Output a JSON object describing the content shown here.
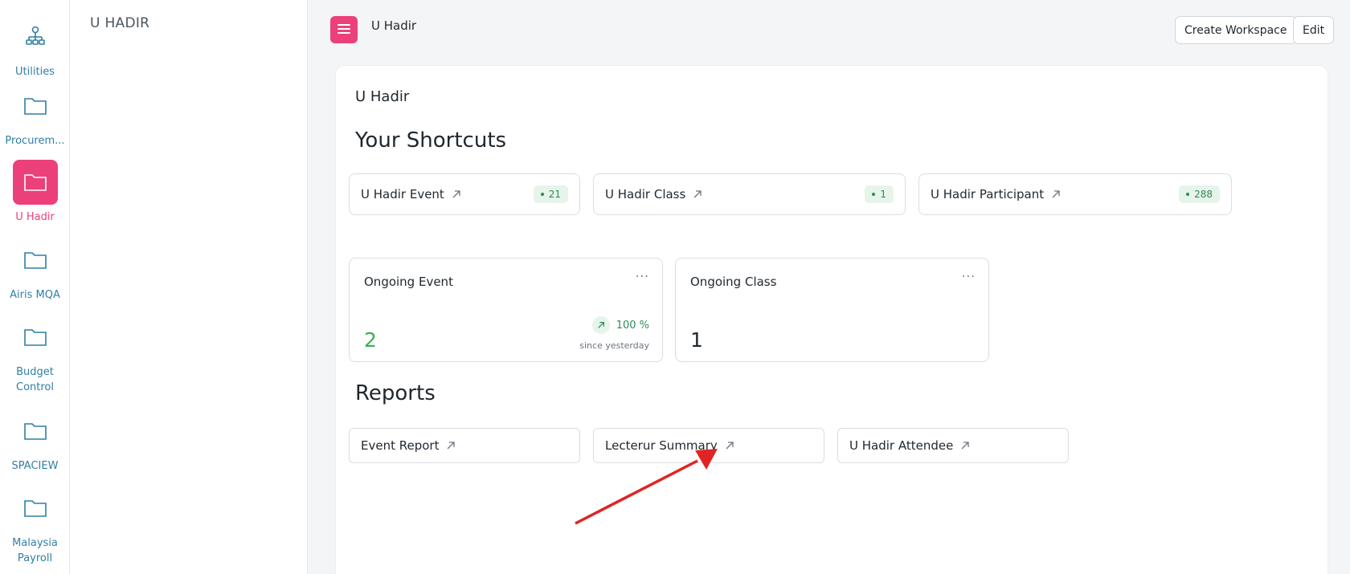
{
  "rail": {
    "items": [
      {
        "label": "Utilities",
        "icon": "sitemap-icon"
      },
      {
        "label": "Procurem...",
        "icon": "folder-icon"
      },
      {
        "label": "U Hadir",
        "icon": "folder-icon",
        "active": true
      },
      {
        "label": "Airis MQA",
        "icon": "folder-icon"
      },
      {
        "label": "Budget",
        "label2": "Control",
        "icon": "folder-icon"
      },
      {
        "label": "SPACIEW",
        "icon": "folder-icon"
      },
      {
        "label": "Malaysia",
        "label2": "Payroll",
        "icon": "folder-icon"
      }
    ]
  },
  "sidebar": {
    "title": "U HADIR"
  },
  "topbar": {
    "title": "U Hadir",
    "create_workspace": "Create Workspace",
    "edit": "Edit"
  },
  "workspace": {
    "title": "U Hadir",
    "shortcuts_heading": "Your Shortcuts",
    "shortcuts": [
      {
        "label": "U Hadir Event",
        "count": "21"
      },
      {
        "label": "U Hadir Class",
        "count": "1"
      },
      {
        "label": "U Hadir Participant",
        "count": "288"
      }
    ],
    "number_cards": [
      {
        "title": "Ongoing Event",
        "value": "2",
        "percent": "100 %",
        "since": "since yesterday",
        "menu": "..."
      },
      {
        "title": "Ongoing Class",
        "value": "1",
        "menu": "..."
      }
    ],
    "reports_heading": "Reports",
    "reports": [
      {
        "label": "Event Report"
      },
      {
        "label": "Lecterur Summary"
      },
      {
        "label": "U Hadir Attendee"
      }
    ]
  },
  "colors": {
    "accent": "#ec407a",
    "rail_text": "#2f7fa6",
    "badge_bg": "#e6f4ea",
    "badge_text": "#2e8b57",
    "annotation_arrow": "#e02424"
  }
}
